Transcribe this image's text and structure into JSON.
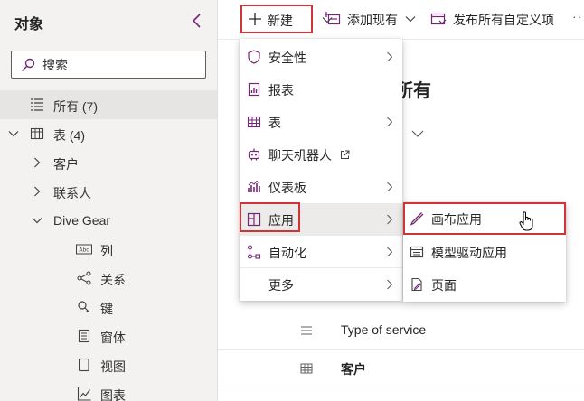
{
  "sidebar": {
    "title": "对象",
    "search_placeholder": "搜索",
    "items": [
      {
        "label": "所有 (7)",
        "icon": "list-icon"
      },
      {
        "label": "表 (4)",
        "icon": "table-icon"
      },
      {
        "label": "客户"
      },
      {
        "label": "联系人"
      },
      {
        "label": "Dive Gear"
      },
      {
        "label": "列",
        "icon": "column-icon"
      },
      {
        "label": "关系",
        "icon": "relationship-icon"
      },
      {
        "label": "键",
        "icon": "key-icon"
      },
      {
        "label": "窗体",
        "icon": "form-icon"
      },
      {
        "label": "视图",
        "icon": "view-icon"
      },
      {
        "label": "图表",
        "icon": "chart-icon"
      }
    ]
  },
  "toolbar": {
    "new_label": "新建",
    "add_existing_label": "添加现有",
    "publish_label": "发布所有自定义项",
    "more_label": "···"
  },
  "main": {
    "title": "所有",
    "rows": [
      {
        "label": "Type of service",
        "icon": "list-icon"
      },
      {
        "label": "客户",
        "icon": "table-icon"
      }
    ]
  },
  "new_menu": {
    "items": [
      {
        "label": "安全性",
        "icon": "shield-icon",
        "has_submenu": true
      },
      {
        "label": "报表",
        "icon": "report-icon",
        "has_submenu": false
      },
      {
        "label": "表",
        "icon": "table-icon",
        "has_submenu": true
      },
      {
        "label": "聊天机器人",
        "icon": "bot-icon",
        "has_submenu": false,
        "external": true
      },
      {
        "label": "仪表板",
        "icon": "dashboard-icon",
        "has_submenu": true
      },
      {
        "label": "应用",
        "icon": "app-icon",
        "has_submenu": true,
        "active": true
      },
      {
        "label": "自动化",
        "icon": "automation-icon",
        "has_submenu": true
      },
      {
        "label": "更多",
        "icon": "",
        "has_submenu": true
      }
    ]
  },
  "app_submenu": {
    "items": [
      {
        "label": "画布应用",
        "icon": "pen-icon",
        "highlighted": true
      },
      {
        "label": "模型驱动应用",
        "icon": "model-app-icon"
      },
      {
        "label": "页面",
        "icon": "page-icon"
      }
    ]
  },
  "colors": {
    "highlight_border": "#d13438",
    "accent": "#742774",
    "sidebar_bg": "#f3f2f1"
  }
}
